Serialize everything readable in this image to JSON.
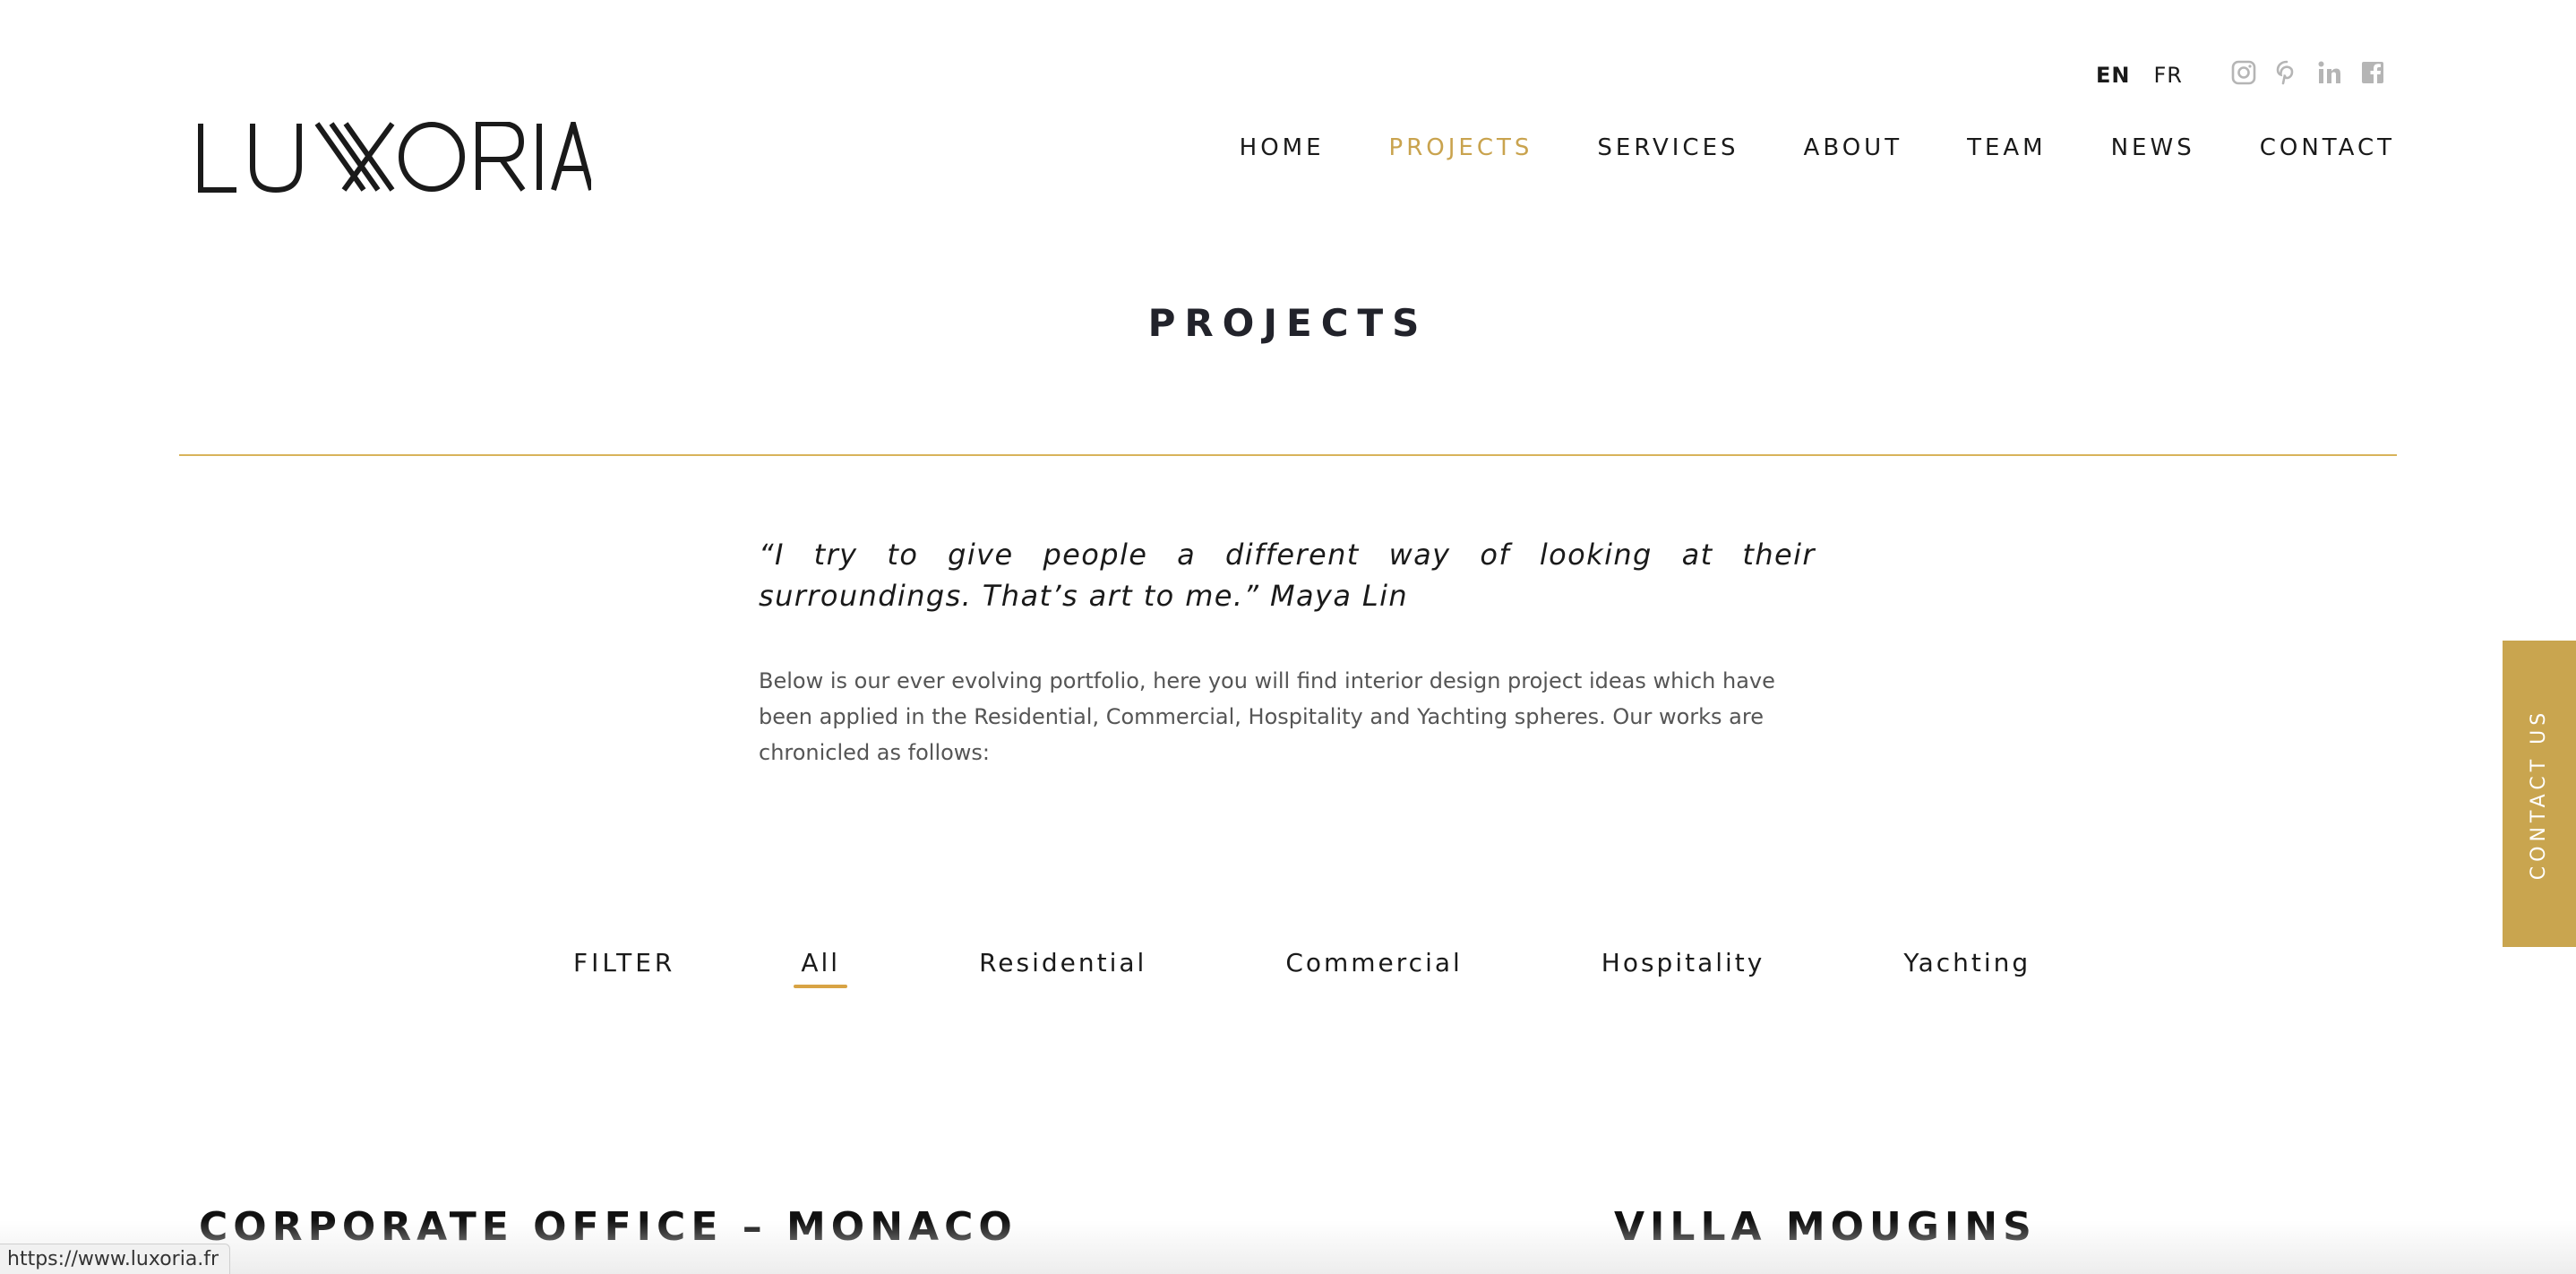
{
  "brand": {
    "name": "LUXORIA",
    "accent_color": "#c9a34e"
  },
  "languages": [
    {
      "label": "EN",
      "active": true
    },
    {
      "label": "FR",
      "active": false
    }
  ],
  "social_icons": [
    "instagram-icon",
    "pinterest-icon",
    "linkedin-icon",
    "facebook-icon"
  ],
  "nav": {
    "items": [
      {
        "label": "HOME"
      },
      {
        "label": "PROJECTS",
        "active": true
      },
      {
        "label": "SERVICES"
      },
      {
        "label": "ABOUT"
      },
      {
        "label": "TEAM"
      },
      {
        "label": "NEWS"
      },
      {
        "label": "CONTACT"
      }
    ]
  },
  "page": {
    "title": "PROJECTS",
    "quote": "“I try to give people a different way of looking at their surroundings. That’s art to me.” Maya Lin",
    "intro": "Below is our ever evolving portfolio, here you will find interior design project ideas which have been applied in the Residential, Commercial, Hospitality and Yachting spheres. Our works are chronicled as follows:"
  },
  "filter": {
    "label": "FILTER",
    "items": [
      {
        "label": "All",
        "active": true
      },
      {
        "label": "Residential"
      },
      {
        "label": "Commercial"
      },
      {
        "label": "Hospitality"
      },
      {
        "label": "Yachting"
      }
    ]
  },
  "projects": [
    {
      "title": "CORPORATE OFFICE – MONACO"
    },
    {
      "title": "VILLA MOUGINS"
    }
  ],
  "side_tab": {
    "label": "CONTACT US",
    "color": "#c9a54f"
  },
  "status_bar": {
    "url": "https://www.luxoria.fr"
  }
}
